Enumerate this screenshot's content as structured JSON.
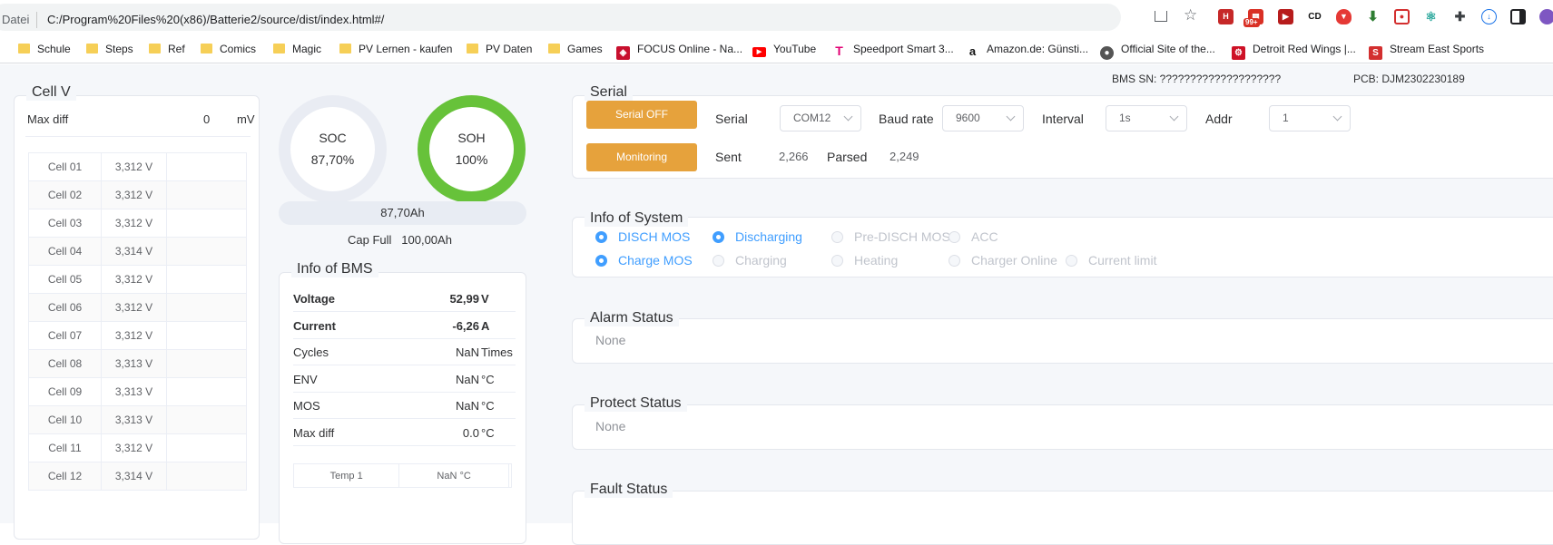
{
  "browser": {
    "protocol_label": "Datei",
    "url": "C:/Program%20Files%20(x86)/Batterie2/source/dist/index.html#/",
    "badge": "99+",
    "bookmarks": [
      {
        "label": "Schule",
        "type": "folder"
      },
      {
        "label": "Steps",
        "type": "folder"
      },
      {
        "label": "Ref",
        "type": "folder"
      },
      {
        "label": "Comics",
        "type": "folder"
      },
      {
        "label": "Magic",
        "type": "folder"
      },
      {
        "label": "PV Lernen - kaufen",
        "type": "folder"
      },
      {
        "label": "PV Daten",
        "type": "folder"
      },
      {
        "label": "Games",
        "type": "folder"
      },
      {
        "label": "FOCUS Online - Na...",
        "type": "site",
        "icon": "focus-icon",
        "color": "#c8102e"
      },
      {
        "label": "YouTube",
        "type": "site",
        "icon": "youtube-icon",
        "color": "#ff0000"
      },
      {
        "label": "Speedport Smart 3...",
        "type": "site",
        "icon": "telekom-icon",
        "color": "#e20074"
      },
      {
        "label": "Amazon.de: Günsti...",
        "type": "site",
        "icon": "amazon-icon",
        "color": "#111111"
      },
      {
        "label": "Official Site of the...",
        "type": "site",
        "icon": "nhl-icon",
        "color": "#555555"
      },
      {
        "label": "Detroit Red Wings |...",
        "type": "site",
        "icon": "redwings-icon",
        "color": "#ce1126"
      },
      {
        "label": "Stream East Sports",
        "type": "site",
        "icon": "streameast-icon",
        "color": "#d32f2f"
      }
    ]
  },
  "header": {
    "bms_sn": "BMS SN: ????????????????????",
    "pcb": "PCB: DJM2302230189"
  },
  "cell_v": {
    "title": "Cell V",
    "max_diff_label": "Max diff",
    "max_diff_value": "0",
    "max_diff_unit": "mV",
    "cells": [
      {
        "name": "Cell 01",
        "value": "3,312 V"
      },
      {
        "name": "Cell 02",
        "value": "3,312 V"
      },
      {
        "name": "Cell 03",
        "value": "3,312 V"
      },
      {
        "name": "Cell 04",
        "value": "3,314 V"
      },
      {
        "name": "Cell 05",
        "value": "3,312 V"
      },
      {
        "name": "Cell 06",
        "value": "3,312 V"
      },
      {
        "name": "Cell 07",
        "value": "3,312 V"
      },
      {
        "name": "Cell 08",
        "value": "3,313 V"
      },
      {
        "name": "Cell 09",
        "value": "3,313 V"
      },
      {
        "name": "Cell 10",
        "value": "3,313 V"
      },
      {
        "name": "Cell 11",
        "value": "3,312 V"
      },
      {
        "name": "Cell 12",
        "value": "3,314 V"
      }
    ]
  },
  "gauges": {
    "soc_label": "SOC",
    "soc_value": "87,70%",
    "soc_fraction": 0.877,
    "soh_label": "SOH",
    "soh_value": "100%",
    "soh_fraction": 1.0,
    "soh_color": "#67c23a",
    "capacity": "87,70Ah",
    "cap_full_label": "Cap Full",
    "cap_full_value": "100,00Ah"
  },
  "info_bms": {
    "title": "Info of BMS",
    "rows": [
      {
        "key": "Voltage",
        "value": "52,99",
        "unit": "V",
        "bold": true
      },
      {
        "key": "Current",
        "value": "-6,26",
        "unit": "A",
        "bold": true
      },
      {
        "key": "Cycles",
        "value": "NaN",
        "unit": "Times",
        "bold": false
      },
      {
        "key": "ENV",
        "value": "NaN",
        "unit": "°C",
        "bold": false
      },
      {
        "key": "MOS",
        "value": "NaN",
        "unit": "°C",
        "bold": false
      },
      {
        "key": "Max diff",
        "value": "0.0",
        "unit": "°C",
        "bold": false
      }
    ],
    "temp_label": "Temp 1",
    "temp_value": "NaN °C"
  },
  "serial": {
    "title": "Serial",
    "serial_off_button": "Serial OFF",
    "monitoring_button": "Monitoring",
    "serial_label": "Serial",
    "serial_value": "COM12",
    "baud_label": "Baud rate",
    "baud_value": "9600",
    "interval_label": "Interval",
    "interval_value": "1s",
    "addr_label": "Addr",
    "addr_value": "1",
    "sent_label": "Sent",
    "sent_value": "2,266",
    "parsed_label": "Parsed",
    "parsed_value": "2,249"
  },
  "system": {
    "title": "Info of System",
    "row1": [
      {
        "label": "DISCH MOS",
        "on": true
      },
      {
        "label": "Discharging",
        "on": true
      },
      {
        "label": "Pre-DISCH MOS",
        "on": false
      },
      {
        "label": "ACC",
        "on": false
      }
    ],
    "row2": [
      {
        "label": "Charge MOS",
        "on": true
      },
      {
        "label": "Charging",
        "on": false
      },
      {
        "label": "Heating",
        "on": false
      },
      {
        "label": "Charger Online",
        "on": false
      },
      {
        "label": "Current limit",
        "on": false
      }
    ]
  },
  "alarm": {
    "title": "Alarm Status",
    "value": "None"
  },
  "protect": {
    "title": "Protect Status",
    "value": "None"
  },
  "fault": {
    "title": "Fault Status"
  }
}
